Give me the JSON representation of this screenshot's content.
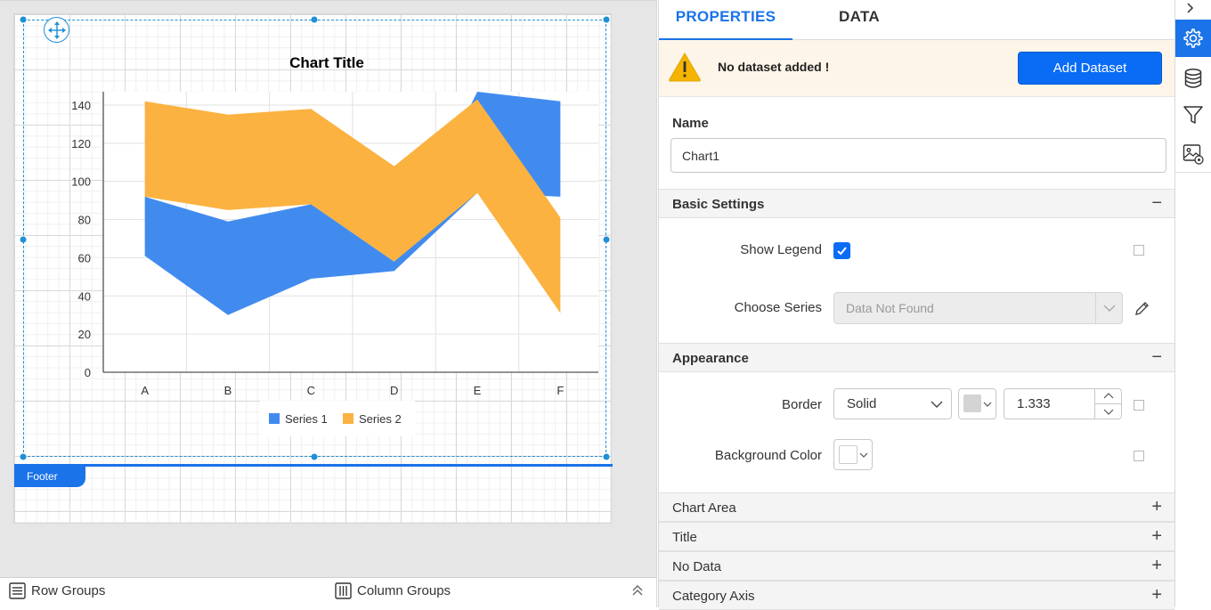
{
  "report": {
    "footer_label": "Footer"
  },
  "groups": {
    "row_label": "Row Groups",
    "column_label": "Column Groups"
  },
  "panel": {
    "tabs": [
      "PROPERTIES",
      "DATA"
    ],
    "warning_text": "No dataset added !",
    "add_dataset_label": "Add Dataset",
    "name_label": "Name",
    "name_value": "Chart1",
    "sections": {
      "basic_settings": "Basic Settings",
      "appearance": "Appearance",
      "chart_area": "Chart Area",
      "title": "Title",
      "no_data": "No Data",
      "category_axis": "Category Axis"
    },
    "show_legend_label": "Show Legend",
    "show_legend_checked": true,
    "choose_series_label": "Choose Series",
    "choose_series_placeholder": "Data Not Found",
    "border_label": "Border",
    "border_style": "Solid",
    "border_width": "1.333",
    "background_color_label": "Background Color"
  },
  "colors": {
    "accent": "#1a73e8",
    "series1": "#418bef",
    "series2": "#fbb240",
    "warning_bg": "#fdf5e8"
  },
  "chart_data": {
    "type": "area",
    "title": "Chart Title",
    "categories": [
      "A",
      "B",
      "C",
      "D",
      "E",
      "F"
    ],
    "ylim": [
      0,
      140
    ],
    "yticks": [
      0,
      20,
      40,
      60,
      80,
      100,
      120,
      140
    ],
    "grid": true,
    "legend_position": "bottom",
    "series": [
      {
        "name": "Series 1",
        "low": [
          61,
          30,
          49,
          53,
          94,
          92
        ],
        "high": [
          92,
          79,
          88,
          58,
          147,
          142
        ]
      },
      {
        "name": "Series 2",
        "low": [
          92,
          85,
          88,
          58,
          94,
          31
        ],
        "high": [
          142,
          135,
          138,
          108,
          143,
          81
        ]
      }
    ]
  }
}
